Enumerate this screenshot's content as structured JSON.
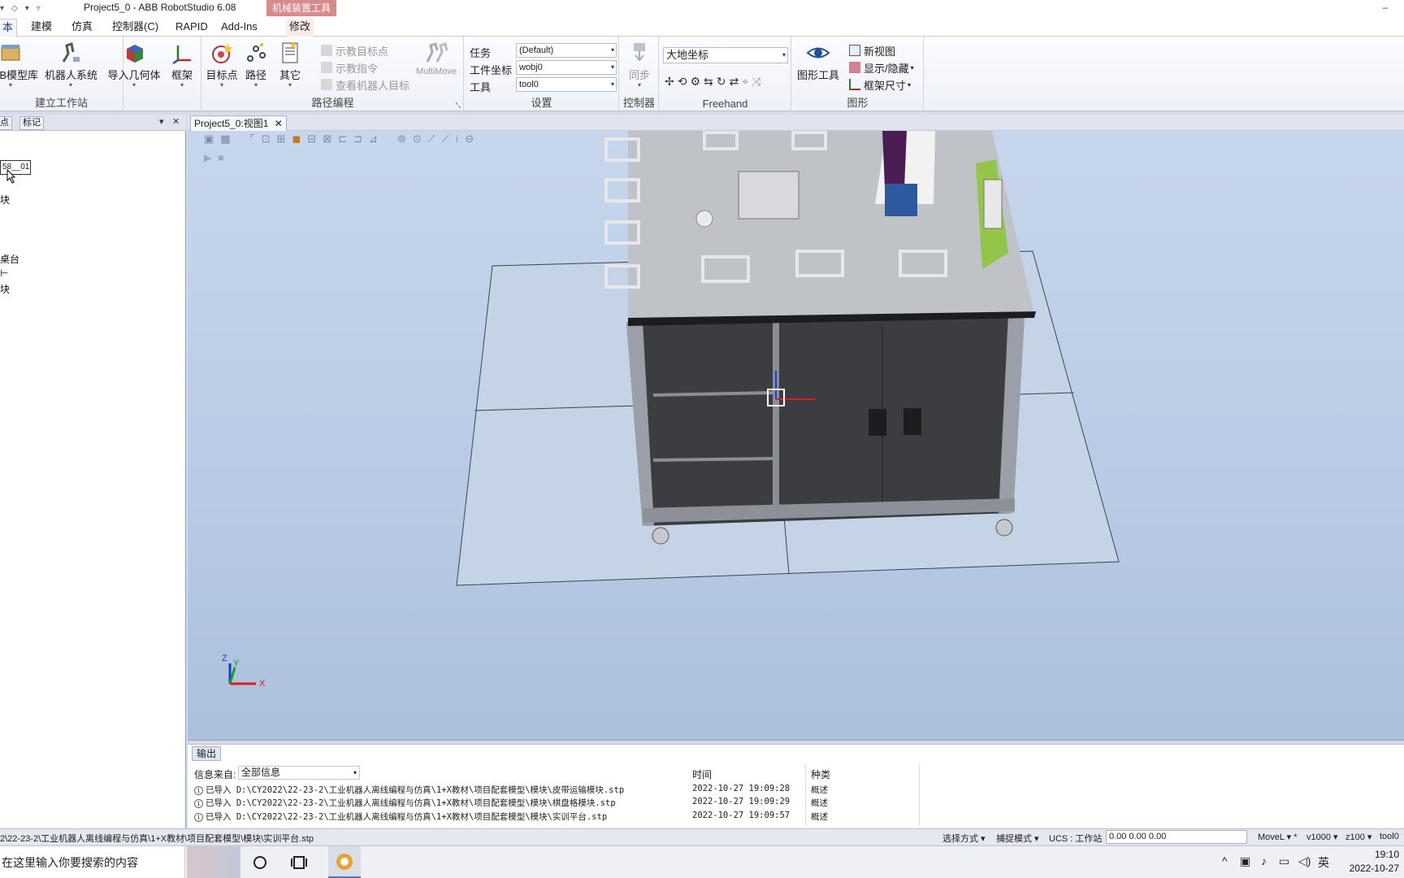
{
  "window": {
    "title": "Project5_0 - ABB RobotStudio 6.08",
    "context_tab_group": "机械装置工具"
  },
  "ribbon_tabs": [
    "本",
    "建模",
    "仿真",
    "控制器(C)",
    "RAPID",
    "Add-Ins",
    "修改"
  ],
  "ribbon": {
    "build_station": {
      "label": "建立工作站",
      "buttons": [
        "ABB模型库",
        "机器人系统",
        "导入几何体",
        "框架"
      ]
    },
    "path_programming": {
      "label": "路径编程",
      "buttons": [
        "目标点",
        "路径",
        "其它"
      ],
      "small_buttons": [
        "示教目标点",
        "示教指令",
        "查看机器人目标"
      ],
      "multimove": "MultiMove"
    },
    "settings": {
      "label": "设置",
      "task_label": "任务",
      "task_value": "(Default)",
      "wobj_label": "工件坐标",
      "wobj_value": "wobj0",
      "tool_label": "工具",
      "tool_value": "tool0"
    },
    "controller": {
      "label": "控制器",
      "sync": "同步"
    },
    "freehand": {
      "label": "Freehand",
      "frame_value": "大地坐标"
    },
    "graphics": {
      "label": "图形",
      "button": "图形工具",
      "small_buttons": [
        "新视图",
        "显示/隐藏",
        "框架尺寸"
      ]
    }
  },
  "left_panel": {
    "tabs": [
      "点",
      "标记"
    ],
    "edit_value": "58__01",
    "items": [
      "块",
      "桌台",
      "",
      "块"
    ]
  },
  "document": {
    "tab": "Project5_0:视图1",
    "axes": [
      "Z",
      "Y",
      "X"
    ]
  },
  "output": {
    "tab": "输出",
    "filter_label": "信息来自:",
    "filter_value": "全部信息",
    "col_time": "时间",
    "col_kind": "种类",
    "rows": [
      {
        "msg": "已导入 D:\\CY2022\\22-23-2\\工业机器人离线编程与仿真\\1+X教材\\项目配套模型\\模块\\皮带运输模块.stp",
        "time": "2022-10-27 19:09:28",
        "kind": "概述"
      },
      {
        "msg": "已导入 D:\\CY2022\\22-23-2\\工业机器人离线编程与仿真\\1+X教材\\项目配套模型\\模块\\棋盘格模块.stp",
        "time": "2022-10-27 19:09:29",
        "kind": "概述"
      },
      {
        "msg": "已导入 D:\\CY2022\\22-23-2\\工业机器人离线编程与仿真\\1+X教材\\项目配套模型\\模块\\实训平台.stp",
        "time": "2022-10-27 19:09:57",
        "kind": "概述"
      }
    ]
  },
  "statusbar": {
    "path": "2\\22-23-2\\工业机器人离线编程与仿真\\1+X教材\\项目配套模型\\模块\\实训平台.stp",
    "select_mode": "选择方式",
    "snap_mode": "捕捉模式",
    "ucs": "UCS : 工作站",
    "coords": "0.00   0.00   0.00",
    "move": "MoveL",
    "speed": "v1000",
    "zone": "z100",
    "tool": "tool0"
  },
  "taskbar": {
    "search_placeholder": "在这里输入你要搜索的内容",
    "ime": "英",
    "time": "19:10",
    "date": "2022-10-27"
  },
  "colors": {
    "viewport_top": "#c7d6ec",
    "viewport_bottom": "#acc0dc",
    "context_tab": "#d98a8a",
    "accent": "#1a3d8f"
  }
}
